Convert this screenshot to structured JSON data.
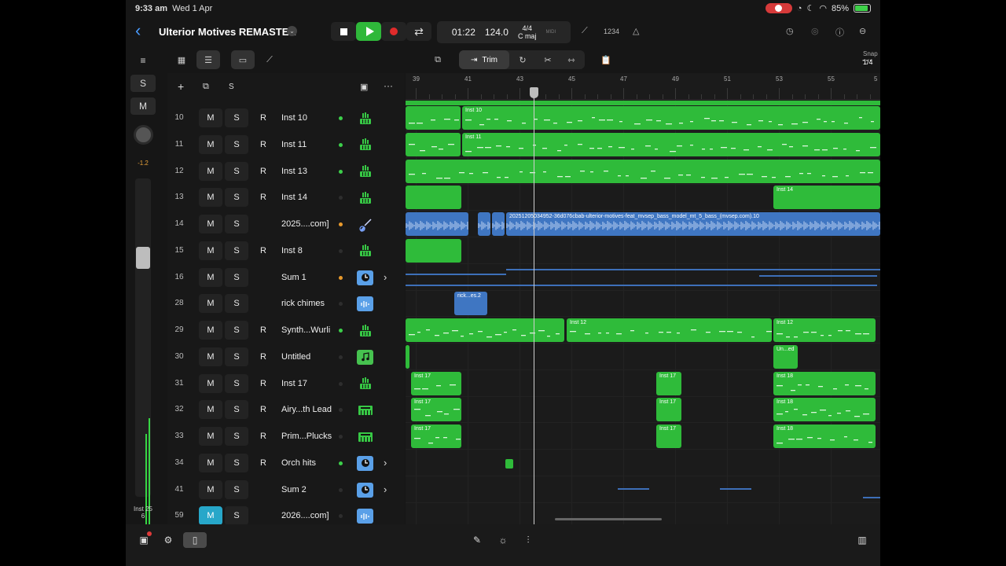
{
  "status": {
    "time": "9:33 am",
    "date": "Wed 1 Apr",
    "battery": "85%"
  },
  "project": {
    "title": "Ulterior Motives REMASTER"
  },
  "transport": {
    "position": "01:22",
    "tempo": "124.0",
    "time_signature": "4/4",
    "key": "C maj",
    "midi": "MIDI",
    "count_in": "1234"
  },
  "toolbar": {
    "trim_label": "Trim",
    "snap_label": "Snap",
    "snap_value": "1/4"
  },
  "left_strip": {
    "solo": "S",
    "mute": "M",
    "knob_value": "-1.2",
    "selected_track": "Inst 25",
    "selected_track_num": "6"
  },
  "header": {
    "add": "+",
    "solo_all": "S",
    "more": "···"
  },
  "ruler": {
    "bars": [
      "39",
      "41",
      "43",
      "45",
      "47",
      "49",
      "51",
      "53",
      "55",
      "5"
    ]
  },
  "tracks": [
    {
      "num": "10",
      "m": "M",
      "s": "S",
      "r": "R",
      "name": "Inst 10",
      "dot": "green",
      "icon": "keyboard-icon"
    },
    {
      "num": "11",
      "m": "M",
      "s": "S",
      "r": "R",
      "name": "Inst 11",
      "dot": "green",
      "icon": "keyboard-icon"
    },
    {
      "num": "12",
      "m": "M",
      "s": "S",
      "r": "R",
      "name": "Inst 13",
      "dot": "green",
      "icon": "keyboard-icon"
    },
    {
      "num": "13",
      "m": "M",
      "s": "S",
      "r": "R",
      "name": "Inst 14",
      "dot": "dark",
      "icon": "keyboard-icon"
    },
    {
      "num": "14",
      "m": "M",
      "s": "S",
      "r": "",
      "name": "2025....com]",
      "dot": "orange",
      "icon": "guitar-icon"
    },
    {
      "num": "15",
      "m": "M",
      "s": "S",
      "r": "R",
      "name": "Inst 8",
      "dot": "dark",
      "icon": "keyboard-icon"
    },
    {
      "num": "16",
      "m": "M",
      "s": "S",
      "r": "",
      "name": "Sum 1",
      "dot": "orange",
      "icon": "summing-icon"
    },
    {
      "num": "28",
      "m": "M",
      "s": "S",
      "r": "",
      "name": "rick chimes",
      "dot": "dark",
      "icon": "waveform-icon"
    },
    {
      "num": "29",
      "m": "M",
      "s": "S",
      "r": "R",
      "name": "Synth...Wurli",
      "dot": "green",
      "icon": "keyboard-icon"
    },
    {
      "num": "30",
      "m": "M",
      "s": "S",
      "r": "R",
      "name": "Untitled",
      "dot": "dark",
      "icon": "note-icon"
    },
    {
      "num": "31",
      "m": "M",
      "s": "S",
      "r": "R",
      "name": "Inst 17",
      "dot": "dark",
      "icon": "keyboard-icon"
    },
    {
      "num": "32",
      "m": "M",
      "s": "S",
      "r": "R",
      "name": "Airy...th Lead",
      "dot": "dark",
      "icon": "synth-icon"
    },
    {
      "num": "33",
      "m": "M",
      "s": "S",
      "r": "R",
      "name": "Prim...Plucks",
      "dot": "dark",
      "icon": "synth-icon"
    },
    {
      "num": "34",
      "m": "M",
      "s": "S",
      "r": "R",
      "name": "Orch hits",
      "dot": "green",
      "icon": "summing-icon"
    },
    {
      "num": "41",
      "m": "M",
      "s": "S",
      "r": "",
      "name": "Sum 2",
      "dot": "dark",
      "icon": "summing-icon"
    },
    {
      "num": "59",
      "m": "M",
      "s": "S",
      "r": "",
      "name": "2026....com]",
      "dot": "dark",
      "icon": "waveform-icon"
    }
  ],
  "regions": {
    "inst10": "Inst 10",
    "inst11": "Inst 11",
    "inst14": "Inst 14",
    "audio14": "20251205034952-36d076cbab-ulterior-motives-feat_mvsep_bass_model_mt_5_bass_(mvsep.com).10",
    "rick": "rick...es.2",
    "inst12a": "Inst 12",
    "inst12b": "Inst 12",
    "untitled": "Un...ed",
    "inst17": "Inst 17",
    "inst18": "Inst 18"
  },
  "colors": {
    "midi_region": "#2fbb3a",
    "audio_region": "#3f76c2",
    "accent": "#4a9cff",
    "record": "#e02b2b",
    "mute_active": "#27a7c9"
  }
}
